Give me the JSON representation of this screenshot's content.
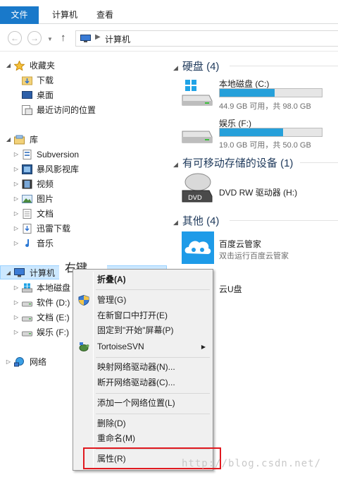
{
  "ribbon": {
    "tabs": [
      "文件",
      "计算机",
      "查看"
    ]
  },
  "address": {
    "crumb": "计算机"
  },
  "tree": {
    "favorites": {
      "label": "收藏夹",
      "items": [
        "下载",
        "桌面",
        "最近访问的位置"
      ]
    },
    "libraries": {
      "label": "库",
      "items": [
        "Subversion",
        "暴风影视库",
        "视频",
        "图片",
        "文档",
        "迅雷下载",
        "音乐"
      ]
    },
    "computer": {
      "label": "计算机",
      "items": [
        "本地磁盘",
        "软件 (D:)",
        "文档 (E:)",
        "娱乐 (F:)"
      ]
    },
    "network": {
      "label": "网络"
    }
  },
  "groups": {
    "hdd": {
      "title": "硬盘 (4)"
    },
    "removable": {
      "title": "有可移动存储的设备 (1)"
    },
    "other": {
      "title": "其他 (4)"
    }
  },
  "drives": [
    {
      "name": "本地磁盘 (C:)",
      "info": "44.9 GB 可用，共 98.0 GB",
      "used_fraction": 0.54
    },
    {
      "name": "娱乐 (F:)",
      "info": "19.0 GB 可用，共 50.0 GB",
      "used_fraction": 0.62
    }
  ],
  "dvd": {
    "name": "DVD RW 驱动器 (H:)",
    "label": "DVD"
  },
  "others": [
    {
      "name": "百度云管家",
      "desc": "双击运行百度云管家"
    },
    {
      "name": "云U盘"
    }
  ],
  "callout": "右键",
  "menu": {
    "items": [
      "折叠(A)",
      "管理(G)",
      "在新窗口中打开(E)",
      "固定到\"开始\"屏幕(P)",
      "TortoiseSVN",
      "映射网络驱动器(N)...",
      "断开网络驱动器(C)...",
      "添加一个网络位置(L)",
      "删除(D)",
      "重命名(M)",
      "属性(R)"
    ]
  },
  "watermark": "http://blog.csdn.net/",
  "colors": {
    "accent": "#1979ca",
    "bar_fill": "#26a0da",
    "highlight": "#e0191f"
  }
}
